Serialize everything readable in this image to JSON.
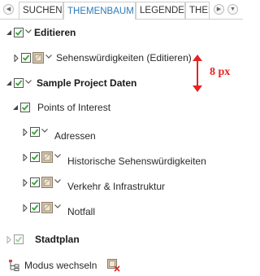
{
  "tabs": [
    {
      "label": "SUCHEN",
      "active": false
    },
    {
      "label": "THEMENBAUM",
      "active": true
    },
    {
      "label": "LEGENDE",
      "active": false
    },
    {
      "label": "THEM",
      "active": false
    }
  ],
  "nav": {
    "prev_icon": "chevron-left-icon",
    "next_icon": "chevron-right-icon",
    "more_icon": "dropdown-icon"
  },
  "tree": {
    "editieren": {
      "label": "Editieren",
      "checked": true
    },
    "sehenswuerdigkeiten_edit": {
      "label": "Sehenswürdigkeiten (Editieren)",
      "checked": true
    },
    "sample_project": {
      "label": "Sample Project Daten",
      "checked": true
    },
    "points_of_interest": {
      "label": "Points of Interest",
      "checked": true
    },
    "adressen": {
      "label": "Adressen",
      "checked": true
    },
    "historische": {
      "label": "Historische Sehenswürdigkeiten",
      "checked": true
    },
    "verkehr": {
      "label": "Verkehr & Infrastruktur",
      "checked": true
    },
    "notfall": {
      "label": "Notfall",
      "checked": true
    },
    "stadtplan": {
      "label": "Stadtplan",
      "checked": true
    }
  },
  "annotation": {
    "label": "8 px",
    "color": "#e52323"
  },
  "footer": {
    "mode_label": "Modus wechseln"
  },
  "colors": {
    "accent": "#2e7ab8",
    "check": "#33a533",
    "annotation": "#e52323"
  }
}
